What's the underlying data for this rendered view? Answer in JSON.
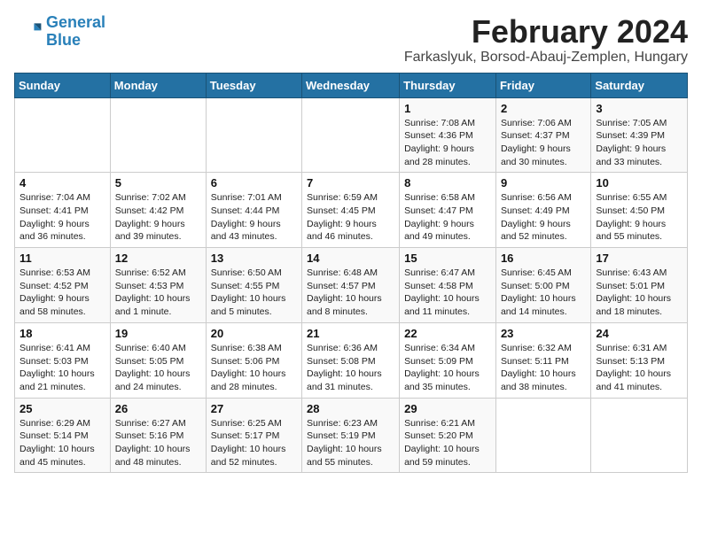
{
  "logo": {
    "line1": "General",
    "line2": "Blue"
  },
  "title": "February 2024",
  "subtitle": "Farkaslyuk, Borsod-Abauj-Zemplen, Hungary",
  "columns": [
    "Sunday",
    "Monday",
    "Tuesday",
    "Wednesday",
    "Thursday",
    "Friday",
    "Saturday"
  ],
  "weeks": [
    [
      {
        "num": "",
        "info": ""
      },
      {
        "num": "",
        "info": ""
      },
      {
        "num": "",
        "info": ""
      },
      {
        "num": "",
        "info": ""
      },
      {
        "num": "1",
        "info": "Sunrise: 7:08 AM\nSunset: 4:36 PM\nDaylight: 9 hours\nand 28 minutes."
      },
      {
        "num": "2",
        "info": "Sunrise: 7:06 AM\nSunset: 4:37 PM\nDaylight: 9 hours\nand 30 minutes."
      },
      {
        "num": "3",
        "info": "Sunrise: 7:05 AM\nSunset: 4:39 PM\nDaylight: 9 hours\nand 33 minutes."
      }
    ],
    [
      {
        "num": "4",
        "info": "Sunrise: 7:04 AM\nSunset: 4:41 PM\nDaylight: 9 hours\nand 36 minutes."
      },
      {
        "num": "5",
        "info": "Sunrise: 7:02 AM\nSunset: 4:42 PM\nDaylight: 9 hours\nand 39 minutes."
      },
      {
        "num": "6",
        "info": "Sunrise: 7:01 AM\nSunset: 4:44 PM\nDaylight: 9 hours\nand 43 minutes."
      },
      {
        "num": "7",
        "info": "Sunrise: 6:59 AM\nSunset: 4:45 PM\nDaylight: 9 hours\nand 46 minutes."
      },
      {
        "num": "8",
        "info": "Sunrise: 6:58 AM\nSunset: 4:47 PM\nDaylight: 9 hours\nand 49 minutes."
      },
      {
        "num": "9",
        "info": "Sunrise: 6:56 AM\nSunset: 4:49 PM\nDaylight: 9 hours\nand 52 minutes."
      },
      {
        "num": "10",
        "info": "Sunrise: 6:55 AM\nSunset: 4:50 PM\nDaylight: 9 hours\nand 55 minutes."
      }
    ],
    [
      {
        "num": "11",
        "info": "Sunrise: 6:53 AM\nSunset: 4:52 PM\nDaylight: 9 hours\nand 58 minutes."
      },
      {
        "num": "12",
        "info": "Sunrise: 6:52 AM\nSunset: 4:53 PM\nDaylight: 10 hours\nand 1 minute."
      },
      {
        "num": "13",
        "info": "Sunrise: 6:50 AM\nSunset: 4:55 PM\nDaylight: 10 hours\nand 5 minutes."
      },
      {
        "num": "14",
        "info": "Sunrise: 6:48 AM\nSunset: 4:57 PM\nDaylight: 10 hours\nand 8 minutes."
      },
      {
        "num": "15",
        "info": "Sunrise: 6:47 AM\nSunset: 4:58 PM\nDaylight: 10 hours\nand 11 minutes."
      },
      {
        "num": "16",
        "info": "Sunrise: 6:45 AM\nSunset: 5:00 PM\nDaylight: 10 hours\nand 14 minutes."
      },
      {
        "num": "17",
        "info": "Sunrise: 6:43 AM\nSunset: 5:01 PM\nDaylight: 10 hours\nand 18 minutes."
      }
    ],
    [
      {
        "num": "18",
        "info": "Sunrise: 6:41 AM\nSunset: 5:03 PM\nDaylight: 10 hours\nand 21 minutes."
      },
      {
        "num": "19",
        "info": "Sunrise: 6:40 AM\nSunset: 5:05 PM\nDaylight: 10 hours\nand 24 minutes."
      },
      {
        "num": "20",
        "info": "Sunrise: 6:38 AM\nSunset: 5:06 PM\nDaylight: 10 hours\nand 28 minutes."
      },
      {
        "num": "21",
        "info": "Sunrise: 6:36 AM\nSunset: 5:08 PM\nDaylight: 10 hours\nand 31 minutes."
      },
      {
        "num": "22",
        "info": "Sunrise: 6:34 AM\nSunset: 5:09 PM\nDaylight: 10 hours\nand 35 minutes."
      },
      {
        "num": "23",
        "info": "Sunrise: 6:32 AM\nSunset: 5:11 PM\nDaylight: 10 hours\nand 38 minutes."
      },
      {
        "num": "24",
        "info": "Sunrise: 6:31 AM\nSunset: 5:13 PM\nDaylight: 10 hours\nand 41 minutes."
      }
    ],
    [
      {
        "num": "25",
        "info": "Sunrise: 6:29 AM\nSunset: 5:14 PM\nDaylight: 10 hours\nand 45 minutes."
      },
      {
        "num": "26",
        "info": "Sunrise: 6:27 AM\nSunset: 5:16 PM\nDaylight: 10 hours\nand 48 minutes."
      },
      {
        "num": "27",
        "info": "Sunrise: 6:25 AM\nSunset: 5:17 PM\nDaylight: 10 hours\nand 52 minutes."
      },
      {
        "num": "28",
        "info": "Sunrise: 6:23 AM\nSunset: 5:19 PM\nDaylight: 10 hours\nand 55 minutes."
      },
      {
        "num": "29",
        "info": "Sunrise: 6:21 AM\nSunset: 5:20 PM\nDaylight: 10 hours\nand 59 minutes."
      },
      {
        "num": "",
        "info": ""
      },
      {
        "num": "",
        "info": ""
      }
    ]
  ]
}
